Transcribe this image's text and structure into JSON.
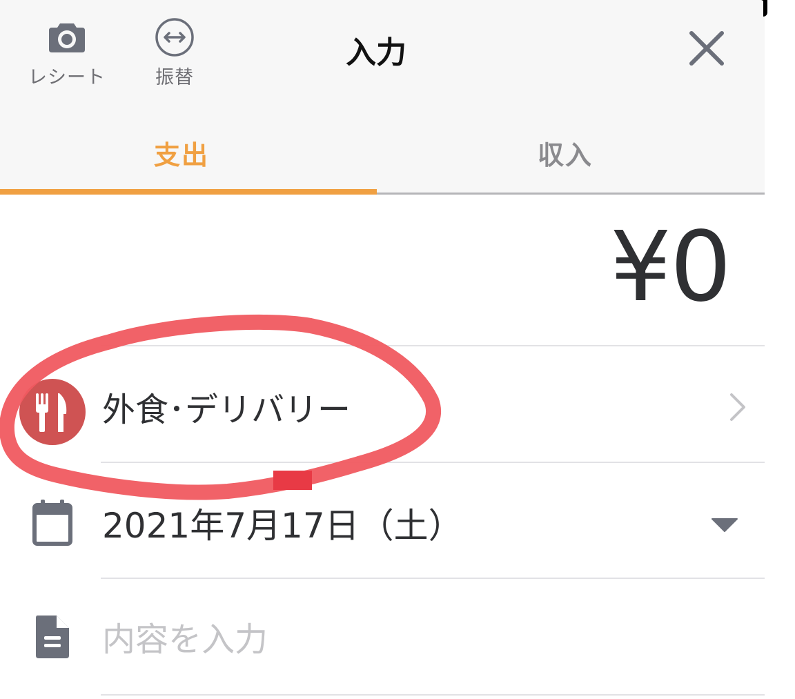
{
  "header": {
    "title": "入力",
    "tools": {
      "receipt_label": "レシート",
      "transfer_label": "振替"
    }
  },
  "tabs": [
    {
      "label": "支出",
      "active": true
    },
    {
      "label": "収入",
      "active": false
    }
  ],
  "amount": {
    "display": "¥0"
  },
  "form": {
    "category": {
      "label": "外食･デリバリー",
      "icon": "fork-knife-icon"
    },
    "date": {
      "value": "2021年7月17日（土）",
      "icon": "calendar-icon"
    },
    "memo": {
      "placeholder": "内容を入力",
      "value": "",
      "icon": "document-icon"
    }
  },
  "colors": {
    "accent": "#f0a042",
    "category_badge": "#cf5353",
    "annotation_mark": "#f05a60",
    "header_bg": "#f7f7f7",
    "text": "#2f3033",
    "muted": "#8a8a8e"
  }
}
